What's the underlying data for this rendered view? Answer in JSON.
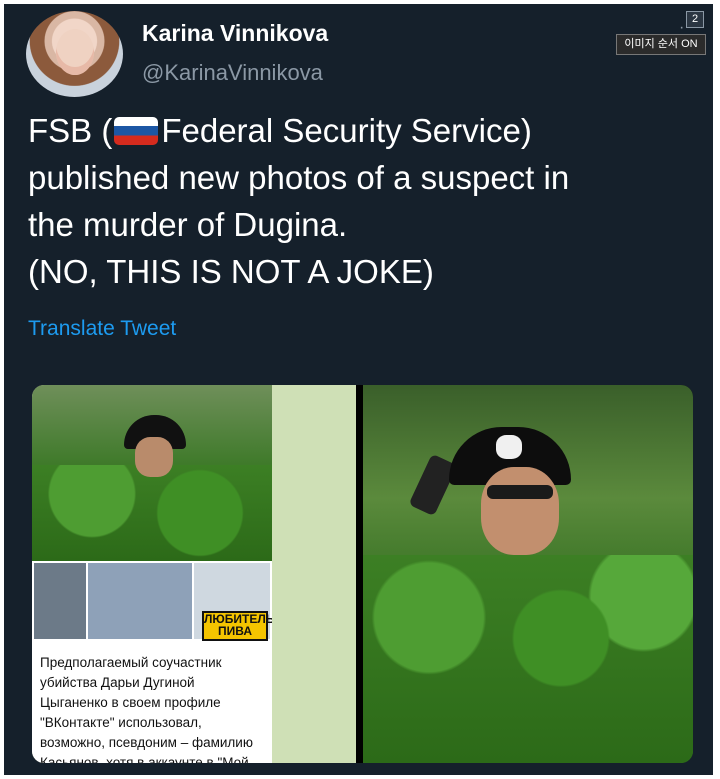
{
  "author": {
    "name": "Karina Vinnikova",
    "handle": "@KarinaVinnikova"
  },
  "overlay": {
    "counter": "2",
    "label": "이미지 순서 ON"
  },
  "tweet": {
    "line1_pre": "FSB (",
    "line1_post": "Federal Security Service)",
    "line2": "published new photos of a suspect in",
    "line3": "the murder of Dugina.",
    "line4": "(NO, THIS IS NOT A JOKE)",
    "flag_icon": "russia-flag-icon"
  },
  "translate_label": "Translate Tweet",
  "media": {
    "beer_sign": "ЛЮБИТЕЛЬ\nПИВА",
    "caption": "Предполагаемый соучастник\nубийства Дарьи Дугиной\nЦыганенко в своем профиле\n\"ВКонтакте\" использовал,\nвозможно, псевдоним – фамилию\nКасьянов, хотя в аккаунте в \"Мой"
  },
  "colors": {
    "background": "#15202b",
    "accent": "#1d9bf0",
    "muted": "#8b98a5"
  }
}
